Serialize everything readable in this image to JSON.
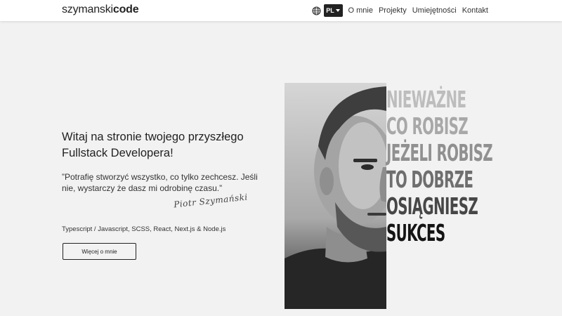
{
  "navbar": {
    "brand_plain": "szymanski",
    "brand_bold": "code",
    "globe_icon": "globe-icon",
    "language": "PL",
    "links": [
      "O mnie",
      "Projekty",
      "Umiejętności",
      "Kontakt"
    ]
  },
  "hero": {
    "headline": "Witaj na stronie twojego przyszłego Fullstack Developera!",
    "quote": "”Potrafię stworzyć wszystko, co tylko zechcesz. Jeśli nie, wystarczy że dasz mi odrobinę czasu.”",
    "signature": "Piotr Szymański",
    "technologies": "Typescript / Javascript, SCSS, React, Next.js & Node.js",
    "more_button": "Więcej o mnie"
  },
  "motto": {
    "lines": [
      "NIEWAŻNE",
      "CO ROBISZ",
      "JEŻELI ROBISZ",
      "TO DOBRZE",
      "OSIĄGNIESZ",
      "SUKCES"
    ]
  },
  "colors": {
    "background": "#f2f2f2",
    "navbar": "#ffffff",
    "text": "#222222",
    "language_button": "#222222"
  }
}
